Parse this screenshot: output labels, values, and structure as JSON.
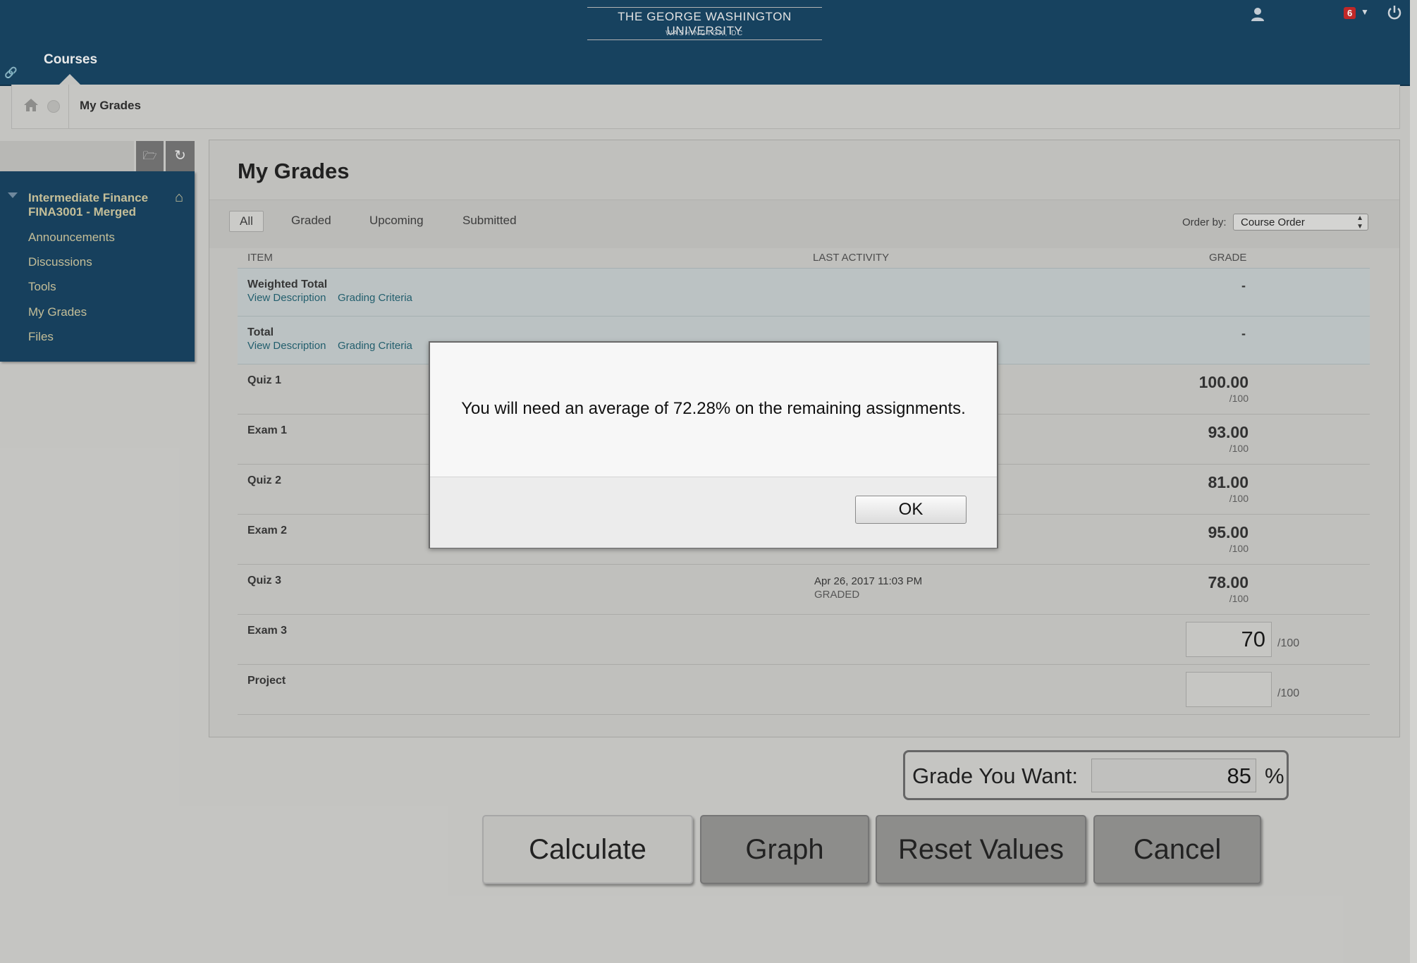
{
  "header": {
    "university_name": "THE GEORGE WASHINGTON UNIVERSITY",
    "university_location": "WASHINGTON, DC",
    "courses_tab": "Courses",
    "notification_count": "6"
  },
  "breadcrumb": {
    "current": "My Grades"
  },
  "course_menu": {
    "course_title": "Intermediate Finance FINA3001 - Merged",
    "items": [
      "Announcements",
      "Discussions",
      "Tools",
      "My Grades",
      "Files"
    ]
  },
  "main": {
    "title": "My Grades",
    "tabs": [
      "All",
      "Graded",
      "Upcoming",
      "Submitted"
    ],
    "order_by_label": "Order by:",
    "order_by_value": "Course Order",
    "columns": {
      "item": "ITEM",
      "last_activity": "LAST ACTIVITY",
      "grade": "GRADE"
    },
    "totals": [
      {
        "title": "Weighted Total",
        "link1": "View Description",
        "link2": "Grading Criteria",
        "grade": "-"
      },
      {
        "title": "Total",
        "link1": "View Description",
        "link2": "Grading Criteria",
        "grade": "-"
      }
    ],
    "rows": [
      {
        "title": "Quiz 1",
        "grade": "100.00",
        "max": "/100"
      },
      {
        "title": "Exam 1",
        "grade": "93.00",
        "max": "/100"
      },
      {
        "title": "Quiz 2",
        "grade": "81.00",
        "max": "/100"
      },
      {
        "title": "Exam 2",
        "grade": "95.00",
        "max": "/100"
      },
      {
        "title": "Quiz 3",
        "activity": "Apr 26, 2017 11:03 PM",
        "status": "GRADED",
        "grade": "78.00",
        "max": "/100"
      },
      {
        "title": "Exam 3",
        "input_value": "70",
        "max": "/100"
      },
      {
        "title": "Project",
        "input_value": "",
        "max": "/100"
      }
    ]
  },
  "calculator": {
    "want_label": "Grade You Want:",
    "want_value": "85",
    "percent": "%",
    "buttons": {
      "calculate": "Calculate",
      "graph": "Graph",
      "reset": "Reset Values",
      "cancel": "Cancel"
    }
  },
  "dialog": {
    "message": "You will need an average of 72.28% on the remaining assignments.",
    "ok_label": "OK"
  }
}
